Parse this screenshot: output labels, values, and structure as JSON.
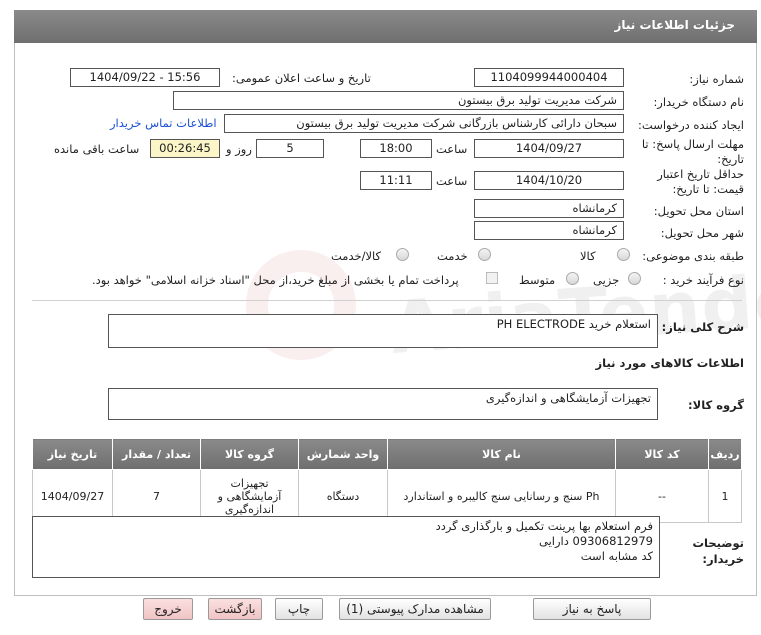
{
  "header": {
    "title": "جزئیات اطلاعات نیاز"
  },
  "fields": {
    "need_number_label": "شماره نیاز:",
    "need_number": "1104099944000404",
    "announce_label": "تاریخ و ساعت اعلان عمومی:",
    "announce_value": "1404/09/22 - 15:56",
    "buyer_org_label": "نام دستگاه خریدار:",
    "buyer_org": "شرکت مدیریت تولید برق بیستون",
    "requester_label": "ایجاد کننده درخواست:",
    "requester": "سبحان دارائی کارشناس بازرگانی شرکت مدیریت تولید برق بیستون",
    "contact_link": "اطلاعات تماس خریدار",
    "deadline_label": "مهلت ارسال پاسخ: تا تاریخ:",
    "deadline_date": "1404/09/27",
    "time_label": "ساعت",
    "deadline_time": "18:00",
    "days_value": "5",
    "days_label": "روز و",
    "remaining_time": "00:26:45",
    "remaining_label": "ساعت باقی مانده",
    "validity_label": "حداقل تاریخ اعتبار قیمت: تا تاریخ:",
    "validity_date": "1404/10/20",
    "validity_time": "11:11",
    "province_label": "استان محل تحویل:",
    "province": "کرمانشاه",
    "city_label": "شهر محل تحویل:",
    "city": "کرمانشاه",
    "category_label": "طبقه بندی موضوعی:",
    "category_options": [
      "کالا",
      "خدمت",
      "کالا/خدمت"
    ],
    "purchase_type_label": "نوع فرآیند خرید :",
    "purchase_options": [
      "جزیی",
      "متوسط"
    ],
    "purchase_note": "پرداخت تمام یا بخشی از مبلغ خرید،از محل \"اسناد خزانه اسلامی\" خواهد بود."
  },
  "summary": {
    "label": "شرح کلی نیاز:",
    "value": "استعلام خرید PH ELECTRODE"
  },
  "goods_section_title": "اطلاعات کالاهای مورد نیاز",
  "goods_group": {
    "label": "گروه کالا:",
    "value": "تجهیزات آزمایشگاهی و اندازه‌گیری"
  },
  "table": {
    "headers": [
      "ردیف",
      "کد کالا",
      "نام کالا",
      "واحد شمارش",
      "گروه کالا",
      "تعداد / مقدار",
      "تاریخ نیاز"
    ],
    "rows": [
      [
        "1",
        "--",
        "Ph سنج و رسانایی سنج کالیبره و استاندارد",
        "دستگاه",
        "تجهیزات آزمایشگاهی و اندازه‌گیری",
        "7",
        "1404/09/27"
      ]
    ]
  },
  "buyer_notes": {
    "label": "توضیحات خریدار:",
    "lines": [
      "فرم استعلام بها پرینت تکمیل و بارگذاری گردد",
      "09306812979 دارایی",
      "کد مشابه است"
    ]
  },
  "buttons": {
    "reply": "پاسخ به نیاز",
    "docs": "مشاهده مدارک پیوستی (1)",
    "print": "چاپ",
    "back": "بازگشت",
    "exit": "خروج"
  },
  "watermark": "AriaTender.net"
}
